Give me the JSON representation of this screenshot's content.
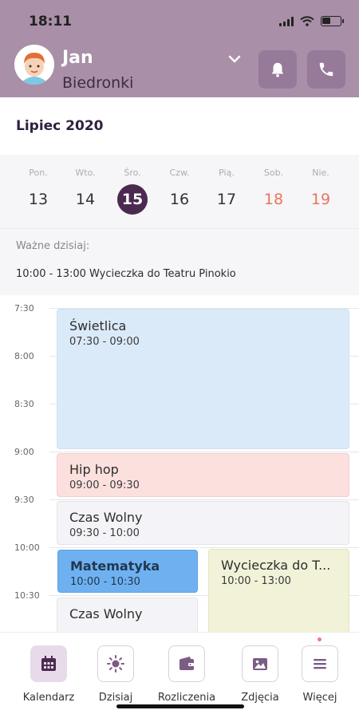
{
  "status_bar": {
    "time": "18:11"
  },
  "header": {
    "user_name": "Jan",
    "group": "Biedronki",
    "icons": {
      "dropdown": "chevron-down-icon",
      "bell": "bell-icon",
      "phone": "phone-icon"
    }
  },
  "calendar": {
    "month_label": "Lipiec 2020",
    "week": [
      {
        "name": "Pon.",
        "date": "13",
        "selected": false,
        "weekend": false
      },
      {
        "name": "Wto.",
        "date": "14",
        "selected": false,
        "weekend": false
      },
      {
        "name": "Śro.",
        "date": "15",
        "selected": true,
        "weekend": false
      },
      {
        "name": "Czw.",
        "date": "16",
        "selected": false,
        "weekend": false
      },
      {
        "name": "Pią.",
        "date": "17",
        "selected": false,
        "weekend": false
      },
      {
        "name": "Sob.",
        "date": "18",
        "selected": false,
        "weekend": true
      },
      {
        "name": "Nie.",
        "date": "19",
        "selected": false,
        "weekend": true
      }
    ]
  },
  "important_today": {
    "label": "Ważne dzisiaj:",
    "event": "10:00 - 13:00 Wycieczka do Teatru Pinokio"
  },
  "timeline": {
    "hours": [
      "7:30",
      "8:00",
      "8:30",
      "9:00",
      "9:30",
      "10:00",
      "10:30"
    ],
    "events": [
      {
        "title": "Świetlica",
        "time": "07:30 - 09:00"
      },
      {
        "title": "Hip hop",
        "time": "09:00 - 09:30"
      },
      {
        "title": "Czas Wolny",
        "time": "09:30 - 10:00"
      },
      {
        "title": "Matematyka",
        "time": "10:00 - 10:30"
      },
      {
        "title": "Czas Wolny",
        "time": ""
      },
      {
        "title": "Wycieczka do T...",
        "time": "10:00 - 13:00"
      }
    ]
  },
  "bottom_nav": [
    {
      "label": "Kalendarz",
      "icon": "calendar-icon",
      "active": true
    },
    {
      "label": "Dzisiaj",
      "icon": "sun-icon",
      "active": false
    },
    {
      "label": "Rozliczenia",
      "icon": "wallet-icon",
      "active": false
    },
    {
      "label": "Zdjęcia",
      "icon": "image-icon",
      "active": false
    },
    {
      "label": "Więcej",
      "icon": "menu-icon",
      "active": false
    }
  ],
  "colors": {
    "header_bg": "#a98fa8",
    "accent_dark": "#4b2a50",
    "weekend": "#e8765f",
    "event_blue": "#dbeaf9",
    "event_pink": "#fbe0de",
    "event_gray": "#f4f4f8",
    "event_highlight": "#6fb1f0",
    "event_yellow": "#f1f2d8"
  }
}
